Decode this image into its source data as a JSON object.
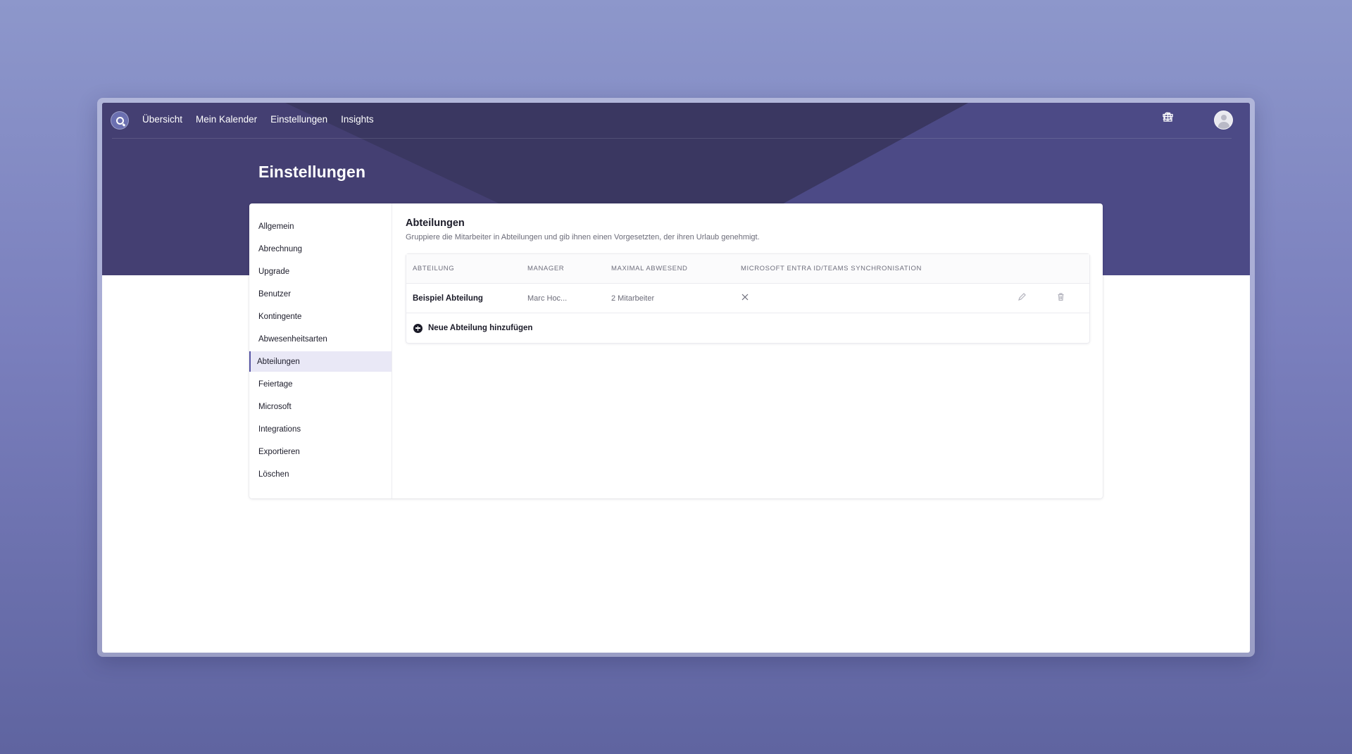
{
  "nav": {
    "items": [
      {
        "label": "Übersicht"
      },
      {
        "label": "Mein Kalender"
      },
      {
        "label": "Einstellungen"
      },
      {
        "label": "Insights"
      }
    ],
    "icons": [
      "bell-icon",
      "gift-icon"
    ]
  },
  "page": {
    "title": "Einstellungen"
  },
  "sidebar": {
    "items": [
      {
        "label": "Allgemein"
      },
      {
        "label": "Abrechnung"
      },
      {
        "label": "Upgrade"
      },
      {
        "label": "Benutzer"
      },
      {
        "label": "Kontingente"
      },
      {
        "label": "Abwesenheitsarten"
      },
      {
        "label": "Abteilungen"
      },
      {
        "label": "Feiertage"
      },
      {
        "label": "Microsoft"
      },
      {
        "label": "Integrations"
      },
      {
        "label": "Exportieren"
      },
      {
        "label": "Löschen"
      }
    ],
    "active": "Abteilungen"
  },
  "section": {
    "title": "Abteilungen",
    "description": "Gruppiere die Mitarbeiter in Abteilungen und gib ihnen einen Vorgesetzten, der ihren Urlaub genehmigt."
  },
  "table": {
    "headers": [
      "ABTEILUNG",
      "MANAGER",
      "MAXIMAL ABWESEND",
      "MICROSOFT ENTRA ID/TEAMS SYNCHRONISATION"
    ],
    "rows": [
      {
        "name": "Beispiel Abteilung",
        "manager": "Marc Hoc...",
        "max_absent": "2 Mitarbeiter",
        "sync": "x-icon"
      }
    ],
    "add_label": "Neue Abteilung hinzufügen"
  },
  "colors": {
    "hero": "#3f3d6d",
    "accent": "#5856a5",
    "active_bg": "#e9e8f6"
  }
}
